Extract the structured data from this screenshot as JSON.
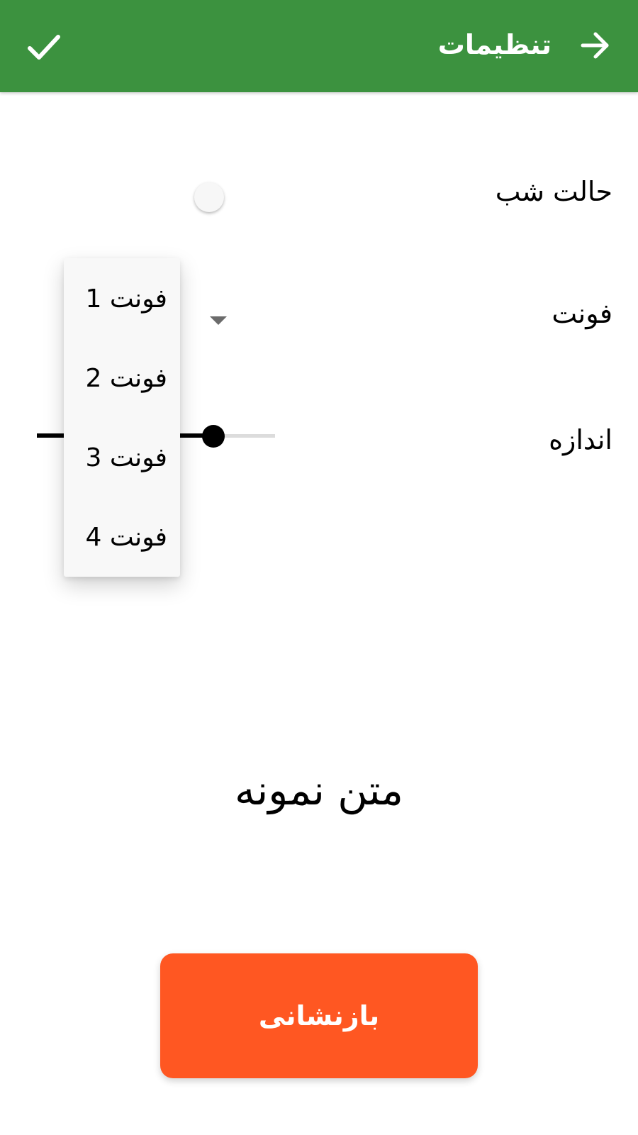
{
  "toolbar": {
    "title": "تنظیمات",
    "back_icon": "arrow-forward-icon",
    "confirm_icon": "check-icon",
    "background_color": "#3c923f"
  },
  "settings": {
    "night_mode_label": "حالت شب",
    "night_mode_on": false,
    "font_label": "فونت",
    "size_label": "اندازه",
    "size_fraction": 0.74
  },
  "font_menu": {
    "items": [
      "فونت 1",
      "فونت 2",
      "فونت 3",
      "فونت 4"
    ]
  },
  "preview": {
    "sample_text": "متن نمونه"
  },
  "reset": {
    "label": "بازنشانی",
    "color": "#ff5722"
  }
}
